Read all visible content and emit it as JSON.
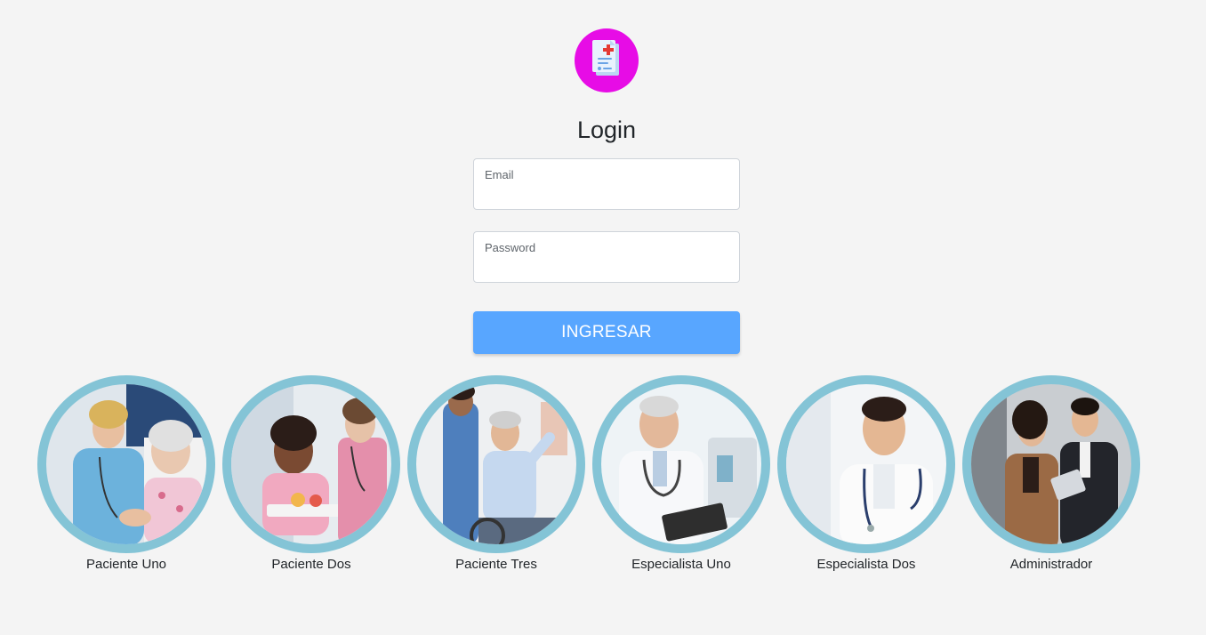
{
  "app": {
    "logo_icon": "medical-report-icon",
    "logo_color": "#e70ce6",
    "title": "Login"
  },
  "form": {
    "email": {
      "label": "Email",
      "value": ""
    },
    "password": {
      "label": "Password",
      "value": ""
    },
    "submit_label": "INGRESAR",
    "submit_color": "#58a6ff"
  },
  "quick_users": {
    "ring_color": "#84c4d6",
    "items": [
      {
        "label": "Paciente Uno",
        "photo": "nurse-with-elderly-patient-photo"
      },
      {
        "label": "Paciente Dos",
        "photo": "patient-in-hospital-bed-photo"
      },
      {
        "label": "Paciente Tres",
        "photo": "patient-in-wheelchair-photo"
      },
      {
        "label": "Especialista Uno",
        "photo": "senior-doctor-photo"
      },
      {
        "label": "Especialista Dos",
        "photo": "young-doctor-photo"
      },
      {
        "label": "Administrador",
        "photo": "business-people-photo"
      }
    ]
  }
}
